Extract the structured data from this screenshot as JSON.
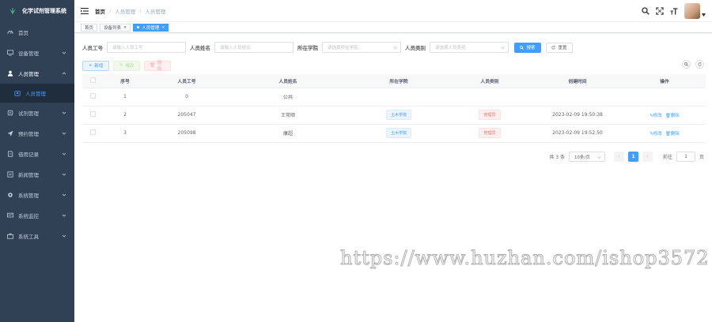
{
  "app": {
    "title": "化学试剂管理系统"
  },
  "sidebar": {
    "items": [
      {
        "label": "首页",
        "icon": "dashboard-icon",
        "expandable": false
      },
      {
        "label": "设备管理",
        "icon": "monitor-icon",
        "expandable": true
      },
      {
        "label": "人员管理",
        "icon": "user-icon",
        "expandable": true,
        "open": true
      },
      {
        "label": "试剂管理",
        "icon": "flask-icon",
        "expandable": true
      },
      {
        "label": "预约管理",
        "icon": "send-icon",
        "expandable": true
      },
      {
        "label": "借用记录",
        "icon": "record-icon",
        "expandable": true
      },
      {
        "label": "新闻管理",
        "icon": "news-icon",
        "expandable": true
      },
      {
        "label": "系统管理",
        "icon": "gear-icon",
        "expandable": true
      },
      {
        "label": "系统监控",
        "icon": "screen-icon",
        "expandable": true
      },
      {
        "label": "系统工具",
        "icon": "toolbox-icon",
        "expandable": true
      }
    ],
    "submenu": {
      "label": "人员管理"
    }
  },
  "navbar": {
    "breadcrumb": [
      "首页",
      "人员管理",
      "人员管理"
    ],
    "sep": "/"
  },
  "tags": [
    {
      "label": "首页",
      "active": false
    },
    {
      "label": "设备列表",
      "active": false,
      "close": "×"
    },
    {
      "label": "人员管理",
      "active": true,
      "close": "×"
    }
  ],
  "search": {
    "fields": [
      {
        "label": "人员工号",
        "placeholder": "请输入人员工号",
        "type": "input"
      },
      {
        "label": "人员姓名",
        "placeholder": "请输入人员姓名",
        "type": "input"
      },
      {
        "label": "所在学院",
        "placeholder": "请选择所在学院",
        "type": "select"
      },
      {
        "label": "人员类别",
        "placeholder": "请选择人员类别",
        "type": "select"
      }
    ],
    "search_label": "搜索",
    "reset_label": "重置"
  },
  "toolbar": {
    "add_label": "新增",
    "edit_label": "修改",
    "delete_label": "删除"
  },
  "table": {
    "columns": [
      "序号",
      "人员工号",
      "人员姓名",
      "所在学院",
      "人员类别",
      "创建时间",
      "操作"
    ],
    "rows": [
      {
        "index": "1",
        "id": "0",
        "name": "公共",
        "college": "",
        "role": "",
        "created": "",
        "ops": false
      },
      {
        "index": "2",
        "id": "205047",
        "name": "王常顺",
        "college": "土木学院",
        "role": "管理员",
        "created": "2023-02-09 19:50:38",
        "ops": true
      },
      {
        "index": "3",
        "id": "205098",
        "name": "康超",
        "college": "土木学院",
        "role": "管理员",
        "created": "2023-02-09 19:52:50",
        "ops": true
      }
    ],
    "op_edit": "修改",
    "op_delete": "删除"
  },
  "pagination": {
    "total_text": "共 3 条",
    "page_size": "10条/页",
    "current_page": "1",
    "jump_prefix": "前往",
    "jump_value": "1",
    "jump_suffix": "页"
  },
  "watermark": "https://www.huzhan.com/ishop3572",
  "colors": {
    "sidebar": "#304156",
    "primary": "#409eff",
    "danger": "#f56c6c"
  }
}
